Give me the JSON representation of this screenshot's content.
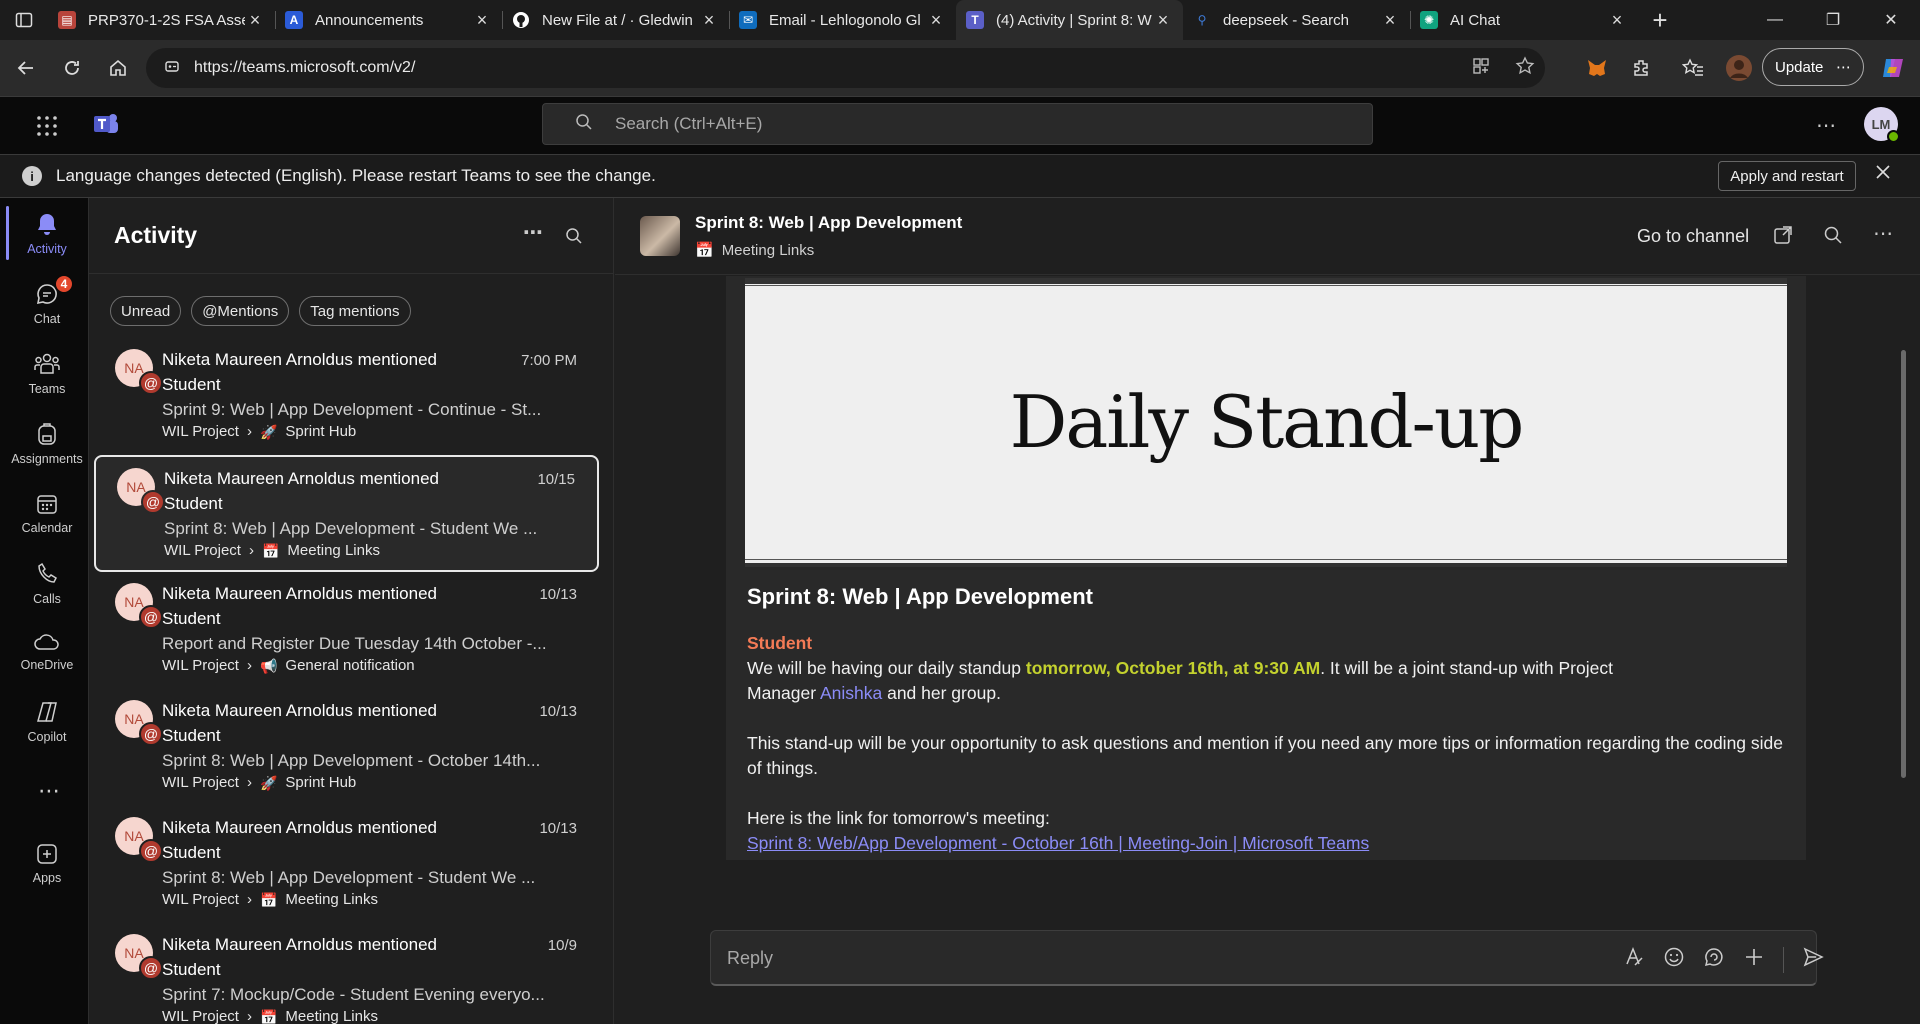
{
  "browser": {
    "tabs": [
      {
        "title": "PRP370-1-2S FSA Asse",
        "favicon_color": "#b8443b",
        "icon": "document-icon",
        "active": false
      },
      {
        "title": "Announcements",
        "favicon_color": "#2b5bd7",
        "icon": "a-logo-icon",
        "active": false
      },
      {
        "title": "New File at / · Gledwin",
        "favicon_color": "#ffffff",
        "icon": "github-icon",
        "active": false
      },
      {
        "title": "Email - Lehlogonolo Gl",
        "favicon_color": "#0f6cbd",
        "icon": "outlook-icon",
        "active": false
      },
      {
        "title": "(4) Activity | Sprint 8: W",
        "favicon_color": "#7b83eb",
        "icon": "teams-icon",
        "active": true
      },
      {
        "title": "deepseek - Search",
        "favicon_color": "#3e7bd8",
        "icon": "search-icon",
        "active": false
      },
      {
        "title": "AI Chat",
        "favicon_color": "#10a37f",
        "icon": "ai-chat-icon",
        "active": false
      }
    ],
    "url": "https://teams.microsoft.com/v2/",
    "update_label": "Update"
  },
  "teams": {
    "search_placeholder": "Search (Ctrl+Alt+E)",
    "user_initials": "LM",
    "banner": {
      "text": "Language changes detected (English). Please restart Teams to see the change.",
      "apply_label": "Apply and restart"
    },
    "rail": [
      {
        "label": "Activity",
        "icon": "bell-icon",
        "active": true
      },
      {
        "label": "Chat",
        "icon": "chat-icon",
        "badge": "4"
      },
      {
        "label": "Teams",
        "icon": "teams-people-icon"
      },
      {
        "label": "Assignments",
        "icon": "backpack-icon"
      },
      {
        "label": "Calendar",
        "icon": "calendar-icon"
      },
      {
        "label": "Calls",
        "icon": "phone-icon"
      },
      {
        "label": "OneDrive",
        "icon": "cloud-icon"
      },
      {
        "label": "Copilot",
        "icon": "copilot-icon"
      },
      {
        "label": "Apps",
        "icon": "apps-icon"
      }
    ],
    "activity": {
      "title": "Activity",
      "filters": [
        "Unread",
        "@Mentions",
        "Tag mentions"
      ],
      "items": [
        {
          "initials": "NA",
          "who": "Niketa Maureen Arnoldus mentioned Student",
          "time": "7:00 PM",
          "preview": "Sprint 9: Web | App Development - Continue - St...",
          "team": "WIL Project",
          "channel": "Sprint Hub",
          "channel_icon": "🚀"
        },
        {
          "initials": "NA",
          "who": "Niketa Maureen Arnoldus mentioned Student",
          "time": "10/15",
          "preview": "Sprint 8: Web | App Development - Student We ...",
          "team": "WIL Project",
          "channel": "Meeting Links",
          "channel_icon": "📅",
          "selected": true
        },
        {
          "initials": "NA",
          "who": "Niketa Maureen Arnoldus mentioned Student",
          "time": "10/13",
          "preview": "Report and Register Due Tuesday 14th October -...",
          "team": "WIL Project",
          "channel": "General notification",
          "channel_icon": "📢"
        },
        {
          "initials": "NA",
          "who": "Niketa Maureen Arnoldus mentioned Student",
          "time": "10/13",
          "preview": "Sprint 8: Web | App Development - October 14th...",
          "team": "WIL Project",
          "channel": "Sprint Hub",
          "channel_icon": "🚀"
        },
        {
          "initials": "NA",
          "who": "Niketa Maureen Arnoldus mentioned Student",
          "time": "10/13",
          "preview": "Sprint 8: Web | App Development - Student We ...",
          "team": "WIL Project",
          "channel": "Meeting Links",
          "channel_icon": "📅"
        },
        {
          "initials": "NA",
          "who": "Niketa Maureen Arnoldus mentioned Student",
          "time": "10/9",
          "preview": "Sprint 7: Mockup/Code - Student Evening everyo...",
          "team": "WIL Project",
          "channel": "Meeting Links",
          "channel_icon": "📅"
        }
      ]
    },
    "conversation": {
      "title": "Sprint 8: Web | App Development",
      "channel": "Meeting Links",
      "channel_icon": "📅",
      "goto_label": "Go to channel",
      "post": {
        "hero_text": "Daily Stand-up",
        "title": "Sprint 8: Web | App Development",
        "mention": "Student",
        "p1_a": "We will be having our daily standup ",
        "p1_highlight": "tomorrow, October 16th, at 9:30 AM",
        "p1_b": ".  It will be a joint stand-up with Project",
        "p1_c": "Manager ",
        "p1_mention": "Anishka",
        "p1_d": " and her group.",
        "p2": "This stand-up will be your opportunity to ask questions and mention if you need any more tips or information regarding the coding side of things.",
        "p3": "Here is the link for tomorrow's meeting:",
        "link": "Sprint 8: Web/App Development - October 16th | Meeting-Join | Microsoft Teams"
      },
      "reply_placeholder": "Reply"
    }
  }
}
